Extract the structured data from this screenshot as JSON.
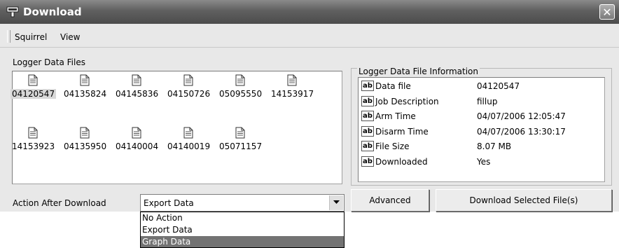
{
  "window": {
    "title": "Download"
  },
  "menu": {
    "items": [
      "Squirrel",
      "View"
    ]
  },
  "files": {
    "group_label": "Logger Data Files",
    "items": [
      {
        "name": "04120547",
        "selected": true
      },
      {
        "name": "04135824"
      },
      {
        "name": "04145836"
      },
      {
        "name": "04150726"
      },
      {
        "name": "05095550"
      },
      {
        "name": "14153917"
      },
      {
        "name": "14153923"
      },
      {
        "name": "04135950"
      },
      {
        "name": "04140004"
      },
      {
        "name": "04140019"
      },
      {
        "name": "05071157"
      }
    ]
  },
  "info": {
    "group_label": "Logger Data File Information",
    "icon_text": "ab",
    "rows": [
      {
        "property": "Data file",
        "value": "04120547"
      },
      {
        "property": "Job Description",
        "value": "fillup"
      },
      {
        "property": "Arm Time",
        "value": "04/07/2006 12:05:47"
      },
      {
        "property": "Disarm Time",
        "value": "04/07/2006 13:30:17"
      },
      {
        "property": "File Size",
        "value": "8.07 MB"
      },
      {
        "property": "Downloaded",
        "value": "Yes"
      }
    ]
  },
  "action": {
    "label": "Action After Download",
    "selected": "Export Data",
    "options": [
      "No Action",
      "Export Data",
      "Graph Data"
    ],
    "highlighted": "Graph Data"
  },
  "buttons": {
    "advanced": "Advanced",
    "download": "Download Selected File(s)"
  },
  "icons": {
    "title": "download-app-icon",
    "close": "close-icon",
    "file": "document-icon",
    "info": "text-field-icon",
    "dropdown": "chevron-down-icon"
  }
}
